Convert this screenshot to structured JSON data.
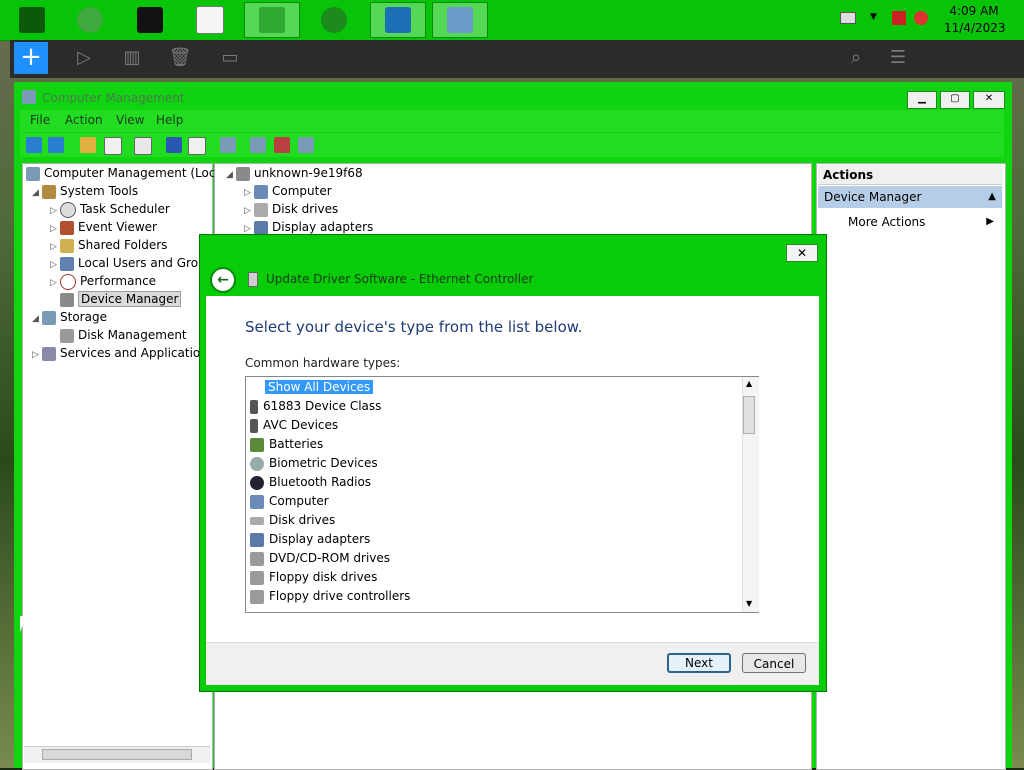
{
  "taskbar": {
    "clock_time": "4:09 AM",
    "clock_date": "11/4/2023"
  },
  "window": {
    "title": "Computer Management",
    "menu": [
      "File",
      "Action",
      "View",
      "Help"
    ]
  },
  "tree": {
    "items": [
      {
        "label": "Computer Management (Local"
      },
      {
        "label": "System Tools"
      },
      {
        "label": "Task Scheduler"
      },
      {
        "label": "Event Viewer"
      },
      {
        "label": "Shared Folders"
      },
      {
        "label": "Local Users and Group"
      },
      {
        "label": "Performance"
      },
      {
        "label": "Device Manager"
      },
      {
        "label": "Storage"
      },
      {
        "label": "Disk Management"
      },
      {
        "label": "Services and Applications"
      }
    ]
  },
  "devices": {
    "root": "unknown-9e19f68",
    "items": [
      "Computer",
      "Disk drives",
      "Display adapters"
    ]
  },
  "actions": {
    "header": "Actions",
    "section": "Device Manager",
    "more": "More Actions"
  },
  "dialog": {
    "title": "Update Driver Software - Ethernet Controller",
    "heading": "Select your device's type from the list below.",
    "list_label": "Common hardware types:",
    "hardware_types": [
      "Show All Devices",
      "61883 Device Class",
      "AVC Devices",
      "Batteries",
      "Biometric Devices",
      "Bluetooth Radios",
      "Computer",
      "Disk drives",
      "Display adapters",
      "DVD/CD-ROM drives",
      "Floppy disk drives",
      "Floppy drive controllers"
    ],
    "selected": "Show All Devices",
    "next_label": "Next",
    "cancel_label": "Cancel"
  }
}
